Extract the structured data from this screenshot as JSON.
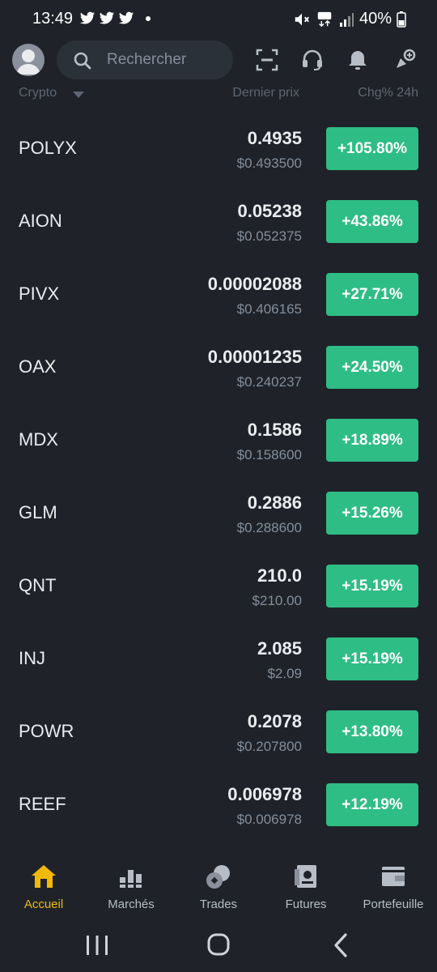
{
  "status_bar": {
    "time": "13:49",
    "battery": "40%"
  },
  "header": {
    "search_placeholder": "Rechercher"
  },
  "columns": {
    "crypto": "Crypto",
    "last_price": "Dernier prix",
    "change": "Chg% 24h"
  },
  "rows": [
    {
      "symbol": "POLYX",
      "price": "0.4935",
      "usd": "$0.493500",
      "change": "+105.80%"
    },
    {
      "symbol": "AION",
      "price": "0.05238",
      "usd": "$0.052375",
      "change": "+43.86%"
    },
    {
      "symbol": "PIVX",
      "price": "0.00002088",
      "usd": "$0.406165",
      "change": "+27.71%"
    },
    {
      "symbol": "OAX",
      "price": "0.00001235",
      "usd": "$0.240237",
      "change": "+24.50%"
    },
    {
      "symbol": "MDX",
      "price": "0.1586",
      "usd": "$0.158600",
      "change": "+18.89%"
    },
    {
      "symbol": "GLM",
      "price": "0.2886",
      "usd": "$0.288600",
      "change": "+15.26%"
    },
    {
      "symbol": "QNT",
      "price": "210.0",
      "usd": "$210.00",
      "change": "+15.19%"
    },
    {
      "symbol": "INJ",
      "price": "2.085",
      "usd": "$2.09",
      "change": "+15.19%"
    },
    {
      "symbol": "POWR",
      "price": "0.2078",
      "usd": "$0.207800",
      "change": "+13.80%"
    },
    {
      "symbol": "REEF",
      "price": "0.006978",
      "usd": "$0.006978",
      "change": "+12.19%"
    }
  ],
  "bottom_nav": [
    {
      "label": "Accueil",
      "icon": "home-icon",
      "active": true
    },
    {
      "label": "Marchés",
      "icon": "markets-icon",
      "active": false
    },
    {
      "label": "Trades",
      "icon": "trades-icon",
      "active": false
    },
    {
      "label": "Futures",
      "icon": "futures-icon",
      "active": false
    },
    {
      "label": "Portefeuille",
      "icon": "wallet-icon",
      "active": false
    }
  ],
  "colors": {
    "background": "#1f2329",
    "positive": "#2ebd85",
    "accent": "#f0b90b",
    "muted": "#848e9c"
  }
}
